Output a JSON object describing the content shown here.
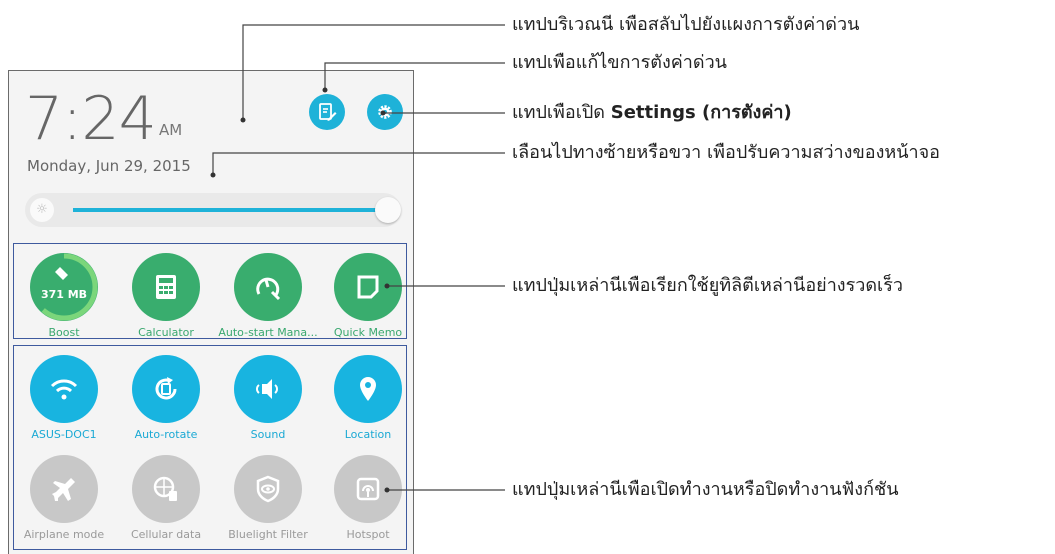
{
  "status": {
    "time": "7:24",
    "ampm": "AM",
    "date": "Monday, Jun 29, 2015"
  },
  "header": {
    "edit_icon": "edit-settings-icon",
    "settings_icon": "gear-icon"
  },
  "brightness": {
    "level_percent": 97
  },
  "shortcuts": [
    {
      "label": "Boost",
      "badge": "371 MB",
      "icon": "broom-icon"
    },
    {
      "label": "Calculator",
      "icon": "calculator-icon"
    },
    {
      "label": "Auto-start Mana...",
      "icon": "gauge-wrench-icon"
    },
    {
      "label": "Quick Memo",
      "icon": "memo-icon"
    }
  ],
  "toggles_on": [
    {
      "label": "ASUS-DOC1",
      "icon": "wifi-icon"
    },
    {
      "label": "Auto-rotate",
      "icon": "rotate-icon"
    },
    {
      "label": "Sound",
      "icon": "speaker-icon"
    },
    {
      "label": "Location",
      "icon": "location-pin-icon"
    }
  ],
  "toggles_off": [
    {
      "label": "Airplane mode",
      "icon": "airplane-icon"
    },
    {
      "label": "Cellular data",
      "icon": "globe-cellular-icon"
    },
    {
      "label": "Bluelight Filter",
      "icon": "eye-shield-icon"
    },
    {
      "label": "Hotspot",
      "icon": "hotspot-icon"
    }
  ],
  "callouts": {
    "panel": "แทปบริเวณนี เพือสลับไปยังแผงการตังค่าด่วน",
    "edit": "แทปเพือแก้ไขการตังค่าด่วน",
    "settings_prefix": "แทปเพือเปิด",
    "settings_bold": "Settings (การตังค่า)",
    "brightness": "เลือนไปทางซ้ายหรือขวา เพือปรับความสว่างของหน้าจอ",
    "shortcuts": "แทปปุ่มเหล่านีเพือเรียกใช้ยูทิลิตีเหล่านีอย่างรวดเร็ว",
    "toggles": "แทปปุ่มเหล่านีเพือเปิดทำงานหรือปิดทำงานฟังก์ชัน"
  },
  "colors": {
    "accent": "#1eb2d8",
    "green": "#39ad6e",
    "off": "#c8c8c8",
    "frame": "#3e5a9e"
  }
}
